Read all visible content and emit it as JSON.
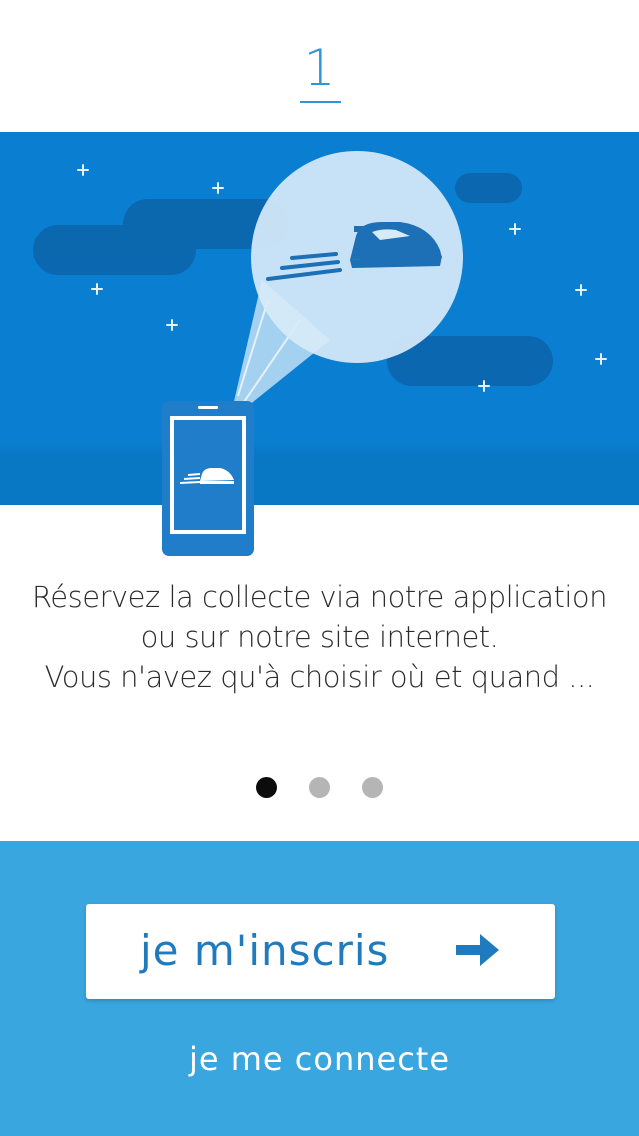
{
  "step": {
    "number": "1"
  },
  "caption": {
    "line1": "Réservez la collecte via notre application",
    "line2": "ou sur notre site internet.",
    "line3": "Vous n'avez qu'à choisir où et quand ..."
  },
  "pager": {
    "total": 3,
    "active_index": 0
  },
  "actions": {
    "signup_label": "je m'inscris",
    "login_label": "je me connecte"
  },
  "icons": {
    "phone": "phone-icon",
    "iron": "iron-icon",
    "arrow": "arrow-right-icon",
    "stars": "star-icon"
  },
  "colors": {
    "accent": "#2f95d6",
    "hero_blue": "#0a7fd1",
    "bottom_blue": "#3aa6e0",
    "button_text": "#1f7bbd"
  }
}
